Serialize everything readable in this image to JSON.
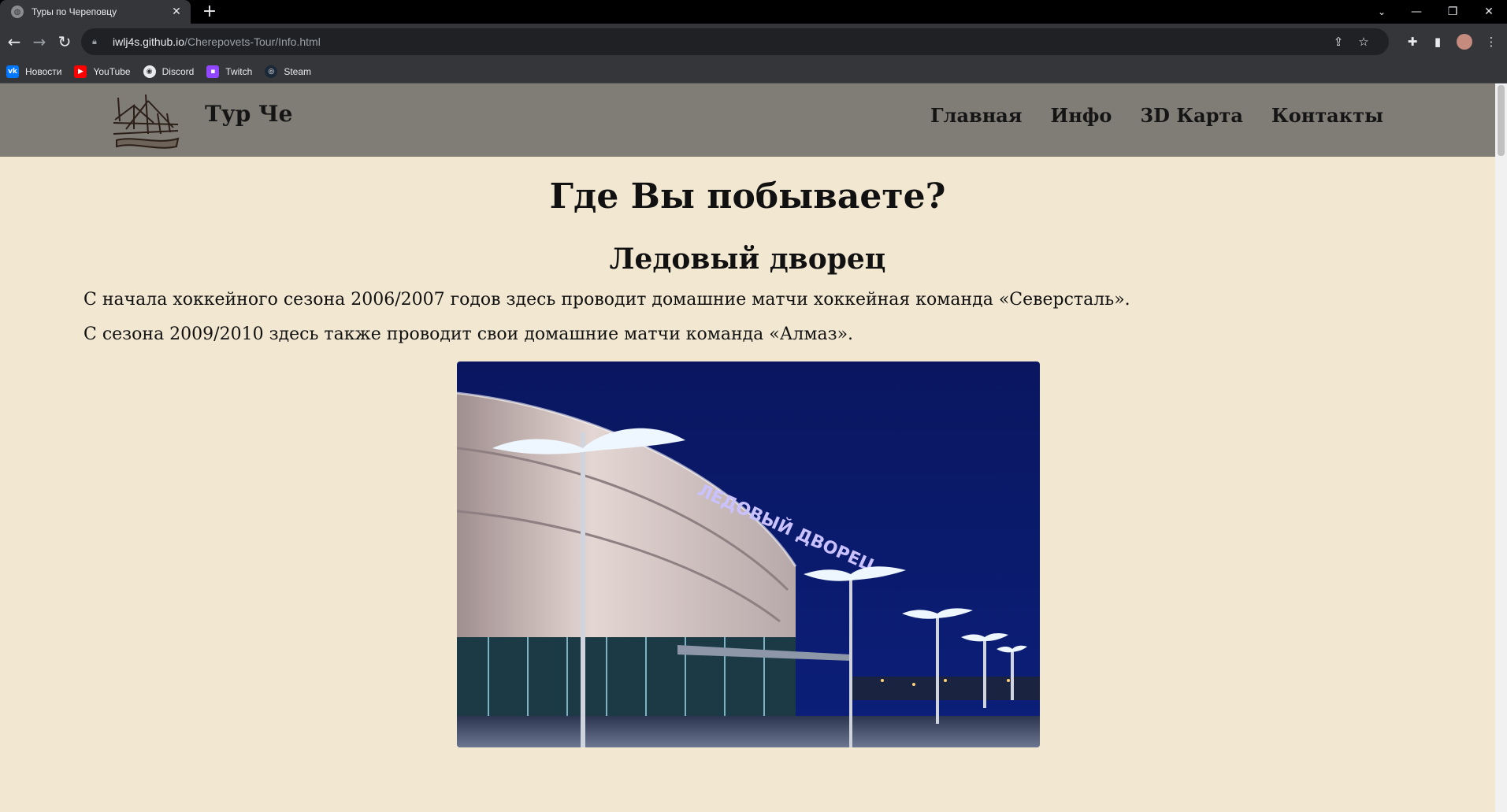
{
  "browser": {
    "tab_title": "Туры по Череповцу",
    "url_host": "iwlj4s.github.io",
    "url_path": "/Cherepovets-Tour/Info.html",
    "bookmarks": [
      {
        "label": "Новости",
        "icon": "vk-icon",
        "color": "#0077ff"
      },
      {
        "label": "YouTube",
        "icon": "youtube-icon",
        "color": "#ff0000"
      },
      {
        "label": "Discord",
        "icon": "discord-icon",
        "color": "#e8eaed"
      },
      {
        "label": "Twitch",
        "icon": "twitch-icon",
        "color": "#9146ff"
      },
      {
        "label": "Steam",
        "icon": "steam-icon",
        "color": "#1b2838"
      }
    ]
  },
  "site": {
    "title": "Тур Че",
    "nav": [
      "Главная",
      "Инфо",
      "3D Карта",
      "Контакты"
    ],
    "colors": {
      "header": "#807d76",
      "background": "#f2e8d2",
      "text": "#111111"
    }
  },
  "content": {
    "main_heading": "Где Вы побываете?",
    "section_heading": "Ледовый дворец",
    "paragraph1": "С начала хоккейного сезона 2006/2007 годов здесь проводит домашние матчи хоккейная команда «Северсталь».",
    "paragraph2": "С сезона 2009/2010 здесь также проводит свои домашние матчи команда «Алмаз».",
    "photo_sign": "ЛЕДОВЫЙ ДВОРЕЦ"
  }
}
